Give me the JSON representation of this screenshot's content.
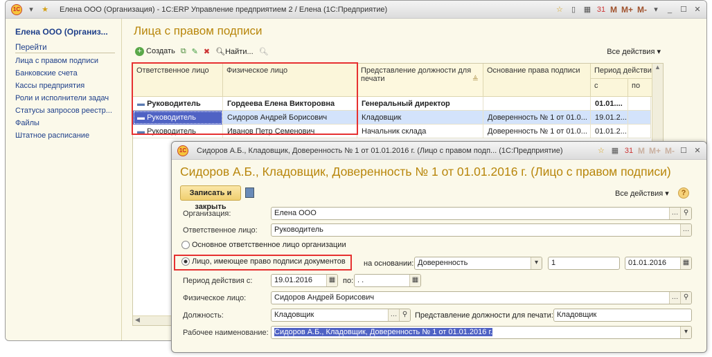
{
  "main_window": {
    "title": "Елена ООО (Организация) - 1С:ERP Управление предприятием 2 / Елена  (1С:Предприятие)",
    "title_buttons": [
      "M",
      "M+",
      "M-"
    ],
    "sidebar": {
      "org": "Елена ООО (Организ...",
      "section": "Перейти",
      "items": [
        "Лица с правом подписи",
        "Банковские счета",
        "Кассы предприятия",
        "Роли и исполнители задач",
        "Статусы запросов реестр...",
        "Файлы",
        "Штатное расписание"
      ]
    },
    "page_title": "Лица с правом подписи",
    "toolbar": {
      "create": "Создать",
      "find": "Найти...",
      "all_actions": "Все действия"
    },
    "table": {
      "headers": [
        "Ответственное лицо",
        "Физическое лицо",
        "Представление должности для печати",
        "Основание права подписи",
        "Период действия"
      ],
      "subheaders": [
        "с",
        "по"
      ],
      "rows": [
        [
          "Руководитель",
          "Гордеева Елена Викторовна",
          "Генеральный директор",
          "",
          "01.01....",
          ""
        ],
        [
          "Руководитель",
          "Сидоров Андрей Борисович",
          "Кладовщик",
          "Доверенность № 1 от 01.0...",
          "19.01.2...",
          ""
        ],
        [
          "Руководитель",
          "Иванов Петр Семенович",
          "Начальник склада",
          "Доверенность № 1 от 01.0...",
          "01.01.2...",
          ""
        ]
      ],
      "selected_row": 1
    }
  },
  "dialog": {
    "title": "Сидоров А.Б., Кладовщик, Доверенность № 1 от 01.01.2016 г. (Лицо с правом подп...  (1С:Предприятие)",
    "title_buttons": [
      "M",
      "M+",
      "M-"
    ],
    "heading": "Сидоров А.Б., Кладовщик, Доверенность № 1 от 01.01.2016 г. (Лицо с правом подписи)",
    "save_close": "Записать и закрыть",
    "all_actions": "Все действия",
    "help": "?",
    "fields": {
      "org_label": "Организация:",
      "org": "Елена ООО",
      "resp_label": "Ответственное лицо:",
      "resp": "Руководитель",
      "radio1": "Основное ответственное лицо организации",
      "radio2": "Лицо, имеющее право подписи документов",
      "basis_label": "на основании:",
      "basis": "Доверенность",
      "basis_num": "1",
      "basis_date": "01.01.2016",
      "period_label": "Период действия с:",
      "period_from": "19.01.2016",
      "period_to_label": "по:",
      "period_to": " .  .",
      "person_label": "Физическое лицо:",
      "person": "Сидоров Андрей Борисович",
      "position_label": "Должность:",
      "position": "Кладовщик",
      "print_label": "Представление должности для печати:",
      "print": "Кладовщик",
      "work_label": "Рабочее наименование:",
      "work": "Сидоров А.Б., Кладовщик, Доверенность № 1 от 01.01.2016 г."
    }
  },
  "colors": {
    "accent_title": "#b8860b",
    "highlight": "#e63030",
    "selection": "#4f62c4",
    "row_selected": "#d3e3fb"
  }
}
